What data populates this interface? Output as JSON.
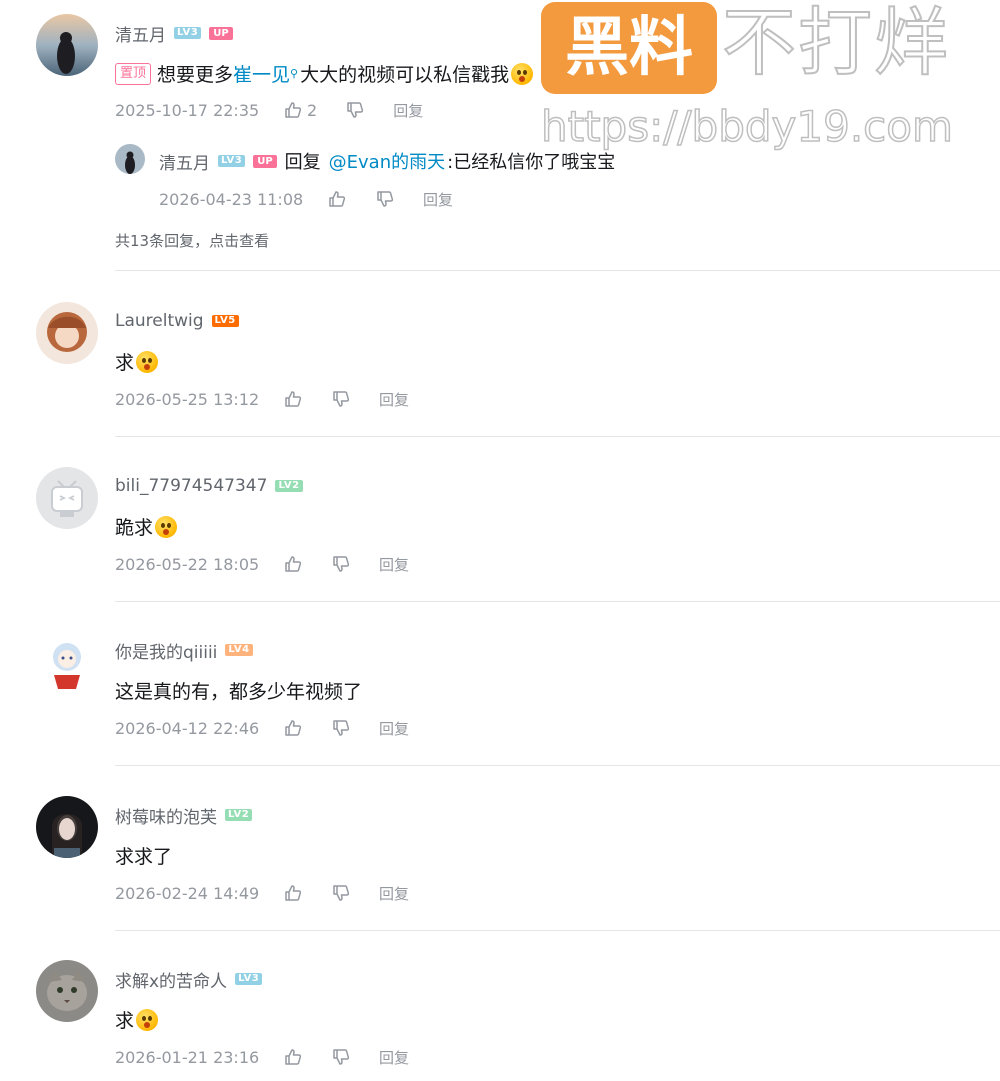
{
  "pinned_comment": {
    "username": "清五月",
    "level": "LV3",
    "up_badge": "UP",
    "pinned_label": "置顶",
    "text_before": "想要更多",
    "link_text": "崔一见",
    "text_after": "大大的视频可以私信戳我",
    "timestamp": "2025-10-17 22:35",
    "likes": "2",
    "reply_label": "回复",
    "sub_reply": {
      "username": "清五月",
      "level": "LV3",
      "up_badge": "UP",
      "reply_word": "回复",
      "mention": "@Evan的雨天",
      "text": ":已经私信你了哦宝宝",
      "timestamp": "2026-04-23 11:08",
      "reply_label": "回复"
    },
    "more_replies": "共13条回复，点击查看"
  },
  "comments": [
    {
      "username": "Laureltwig",
      "level": "LV5",
      "text": "求",
      "timestamp": "2026-05-25 13:12",
      "reply_label": "回复"
    },
    {
      "username": "bili_77974547347",
      "level": "LV2",
      "text": "跪求",
      "timestamp": "2026-05-22 18:05",
      "reply_label": "回复"
    },
    {
      "username": "你是我的qiiiii",
      "level": "LV4",
      "text": "这是真的有，都多少年视频了",
      "timestamp": "2026-04-12 22:46",
      "reply_label": "回复"
    },
    {
      "username": "树莓味的泡芙",
      "level": "LV2",
      "text": "求求了",
      "timestamp": "2026-02-24 14:49",
      "reply_label": "回复"
    },
    {
      "username": "求解x的苦命人",
      "level": "LV3",
      "text": "求",
      "timestamp": "2026-01-21 23:16",
      "reply_label": "回复"
    }
  ],
  "watermark": {
    "boxed": "黑料",
    "outlined": "不打烊",
    "url": "https://bbdy19.com"
  },
  "colors": {
    "accent_pink": "#fb7299",
    "link_blue": "#008ac5",
    "watermark_orange": "#f39a3e",
    "meta_gray": "#9499a0"
  }
}
